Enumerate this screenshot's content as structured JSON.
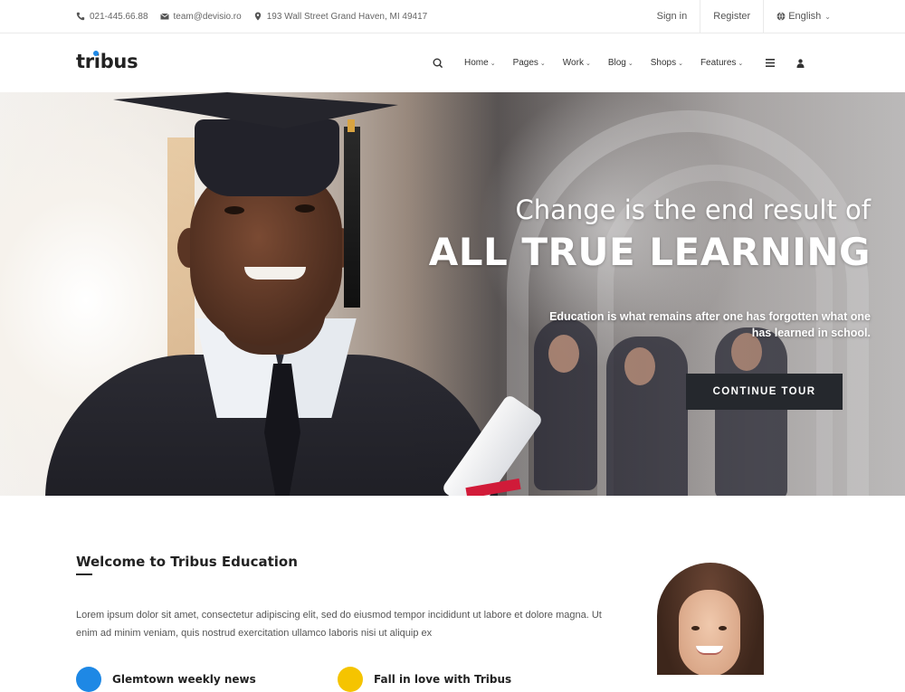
{
  "topbar": {
    "phone": "021-445.66.88",
    "email": "team@devisio.ro",
    "address": "193 Wall Street Grand Haven, MI 49417",
    "signin": "Sign in",
    "register": "Register",
    "language": "English"
  },
  "header": {
    "logo": "tribus",
    "nav": [
      {
        "label": "Home"
      },
      {
        "label": "Pages"
      },
      {
        "label": "Work"
      },
      {
        "label": "Blog"
      },
      {
        "label": "Shops"
      },
      {
        "label": "Features"
      }
    ],
    "icons": [
      "search-icon",
      "menu-icon",
      "user-icon"
    ]
  },
  "hero": {
    "title_line1": "Change is the end result of",
    "title_line2": "ALL TRUE LEARNING",
    "subtitle": "Education is what remains after one has forgotten what one has learned in school.",
    "cta": "CONTINUE TOUR"
  },
  "welcome": {
    "title": "Welcome to Tribus Education",
    "text": "Lorem ipsum dolor sit amet, consectetur adipiscing elit, sed do eiusmod tempor incididunt ut labore et dolore magna. Ut enim ad minim veniam, quis nostrud exercitation ullamco laboris nisi ut aliquip ex",
    "features": [
      {
        "label": "Glemtown weekly news",
        "color": "#1e88e5"
      },
      {
        "label": "Fall in love with Tribus",
        "color": "#f5c400"
      }
    ]
  },
  "colors": {
    "accent": "#1e88e5",
    "cta_bg": "#25282d",
    "text_dark": "#222222"
  }
}
